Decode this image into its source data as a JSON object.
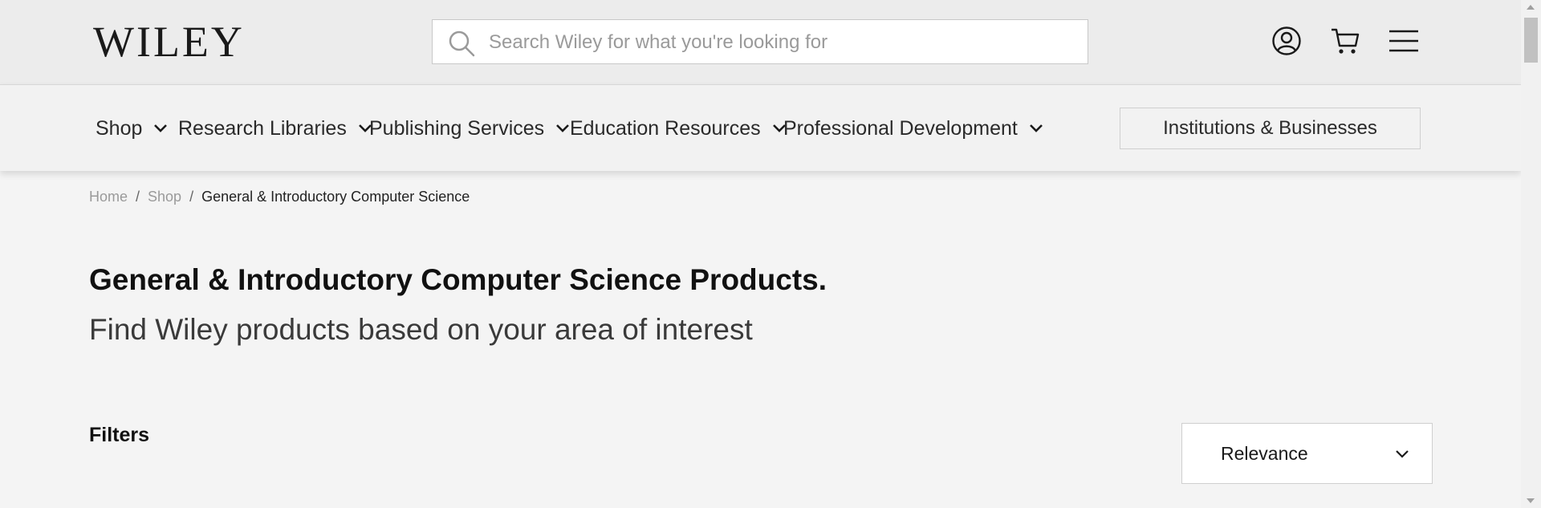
{
  "header": {
    "logo_text": "WILEY",
    "search": {
      "placeholder": "Search Wiley for what you're looking for",
      "value": ""
    },
    "icons": [
      "account-icon",
      "cart-icon",
      "menu-icon"
    ]
  },
  "nav": {
    "items": [
      {
        "label": "Shop"
      },
      {
        "label": "Research Libraries"
      },
      {
        "label": "Publishing Services"
      },
      {
        "label": "Education Resources"
      },
      {
        "label": "Professional Development"
      }
    ],
    "institutions_button": "Institutions & Businesses"
  },
  "breadcrumb": {
    "home": "Home",
    "shop": "Shop",
    "current": "General & Introductory Computer Science",
    "separator": "/"
  },
  "page": {
    "title": "General & Introductory Computer Science Products.",
    "subtitle": "Find Wiley products based on your area of interest"
  },
  "filters": {
    "label": "Filters"
  },
  "sort": {
    "selected": "Relevance"
  },
  "colors": {
    "header_bg": "#ececec",
    "nav_bg": "#f2f2f2",
    "page_bg": "#f4f4f4",
    "text": "#1a1a1a"
  }
}
